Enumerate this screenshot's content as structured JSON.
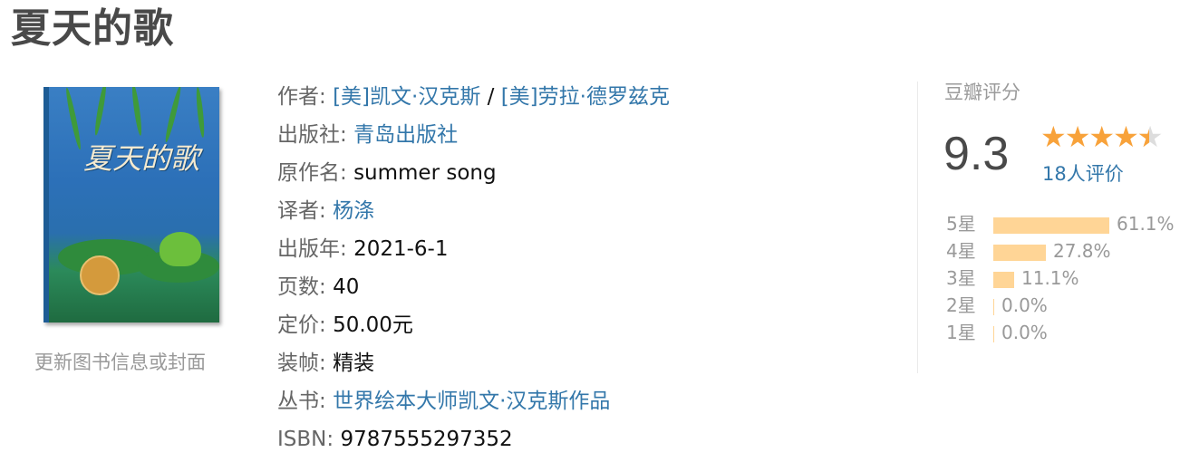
{
  "book": {
    "title": "夏天的歌"
  },
  "cover": {
    "title_text": "夏天的歌",
    "update_link": "更新图书信息或封面"
  },
  "info": {
    "author": {
      "label": "作者:",
      "name1": "[美]凯文·汉克斯",
      "sep": " / ",
      "name2": "[美]劳拉·德罗兹克"
    },
    "publisher": {
      "label": "出版社:",
      "value": "青岛出版社"
    },
    "original_title": {
      "label": "原作名:",
      "value": "summer song"
    },
    "translator": {
      "label": "译者:",
      "value": "杨涤"
    },
    "pub_year": {
      "label": "出版年:",
      "value": "2021-6-1"
    },
    "pages": {
      "label": "页数:",
      "value": "40"
    },
    "price": {
      "label": "定价:",
      "value": "50.00元"
    },
    "binding": {
      "label": "装帧:",
      "value": "精装"
    },
    "series": {
      "label": "丛书:",
      "value": "世界绘本大师凯文·汉克斯作品"
    },
    "isbn": {
      "label": "ISBN:",
      "value": "9787555297352"
    }
  },
  "rating": {
    "label": "豆瓣评分",
    "score": "9.3",
    "stars_value": 4.5,
    "count": "18人评价",
    "star_color": "#f8a23a",
    "bar_color": "#ffd596",
    "distribution": [
      {
        "label": "5星",
        "percent": 61.1,
        "percent_text": "61.1%"
      },
      {
        "label": "4星",
        "percent": 27.8,
        "percent_text": "27.8%"
      },
      {
        "label": "3星",
        "percent": 11.1,
        "percent_text": "11.1%"
      },
      {
        "label": "2星",
        "percent": 0.0,
        "percent_text": "0.0%"
      },
      {
        "label": "1星",
        "percent": 0.0,
        "percent_text": "0.0%"
      }
    ]
  },
  "link_color": "#3377aa"
}
